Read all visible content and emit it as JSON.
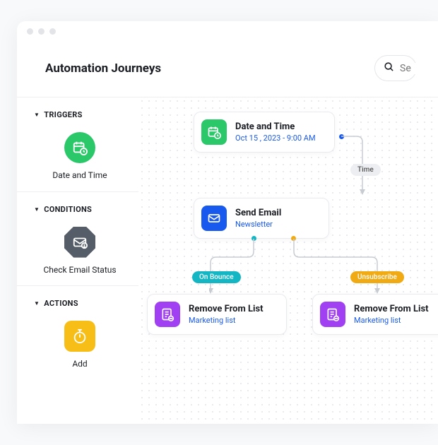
{
  "header": {
    "title": "Automation Journeys",
    "search_placeholder": "Se"
  },
  "sidebar": {
    "triggers": {
      "heading": "TRIGGERS",
      "items": [
        {
          "label": "Date and Time"
        }
      ]
    },
    "conditions": {
      "heading": "CONDITIONS",
      "items": [
        {
          "label": "Check Email Status"
        }
      ]
    },
    "actions": {
      "heading": "ACTIONS",
      "items": [
        {
          "label": "Add"
        }
      ]
    }
  },
  "nodes": {
    "datetime": {
      "title": "Date and Time",
      "sub": "Oct 15 , 2023 - 9:00 AM"
    },
    "sendemail": {
      "title": "Send Email",
      "sub": "Newsletter"
    },
    "remove1": {
      "title": "Remove From List",
      "sub": "Marketing list"
    },
    "remove2": {
      "title": "Remove From List",
      "sub": "Marketing list"
    }
  },
  "pills": {
    "time": "Time",
    "bounce": "On Bounce",
    "unsubscribe": "Unsubscribe"
  },
  "colors": {
    "green": "#2bc86a",
    "blue": "#1859ee",
    "purple": "#a040f2",
    "yellow": "#f8be18",
    "teal": "#14b6c4",
    "orange": "#f0aa14",
    "grey": "#555d68"
  }
}
